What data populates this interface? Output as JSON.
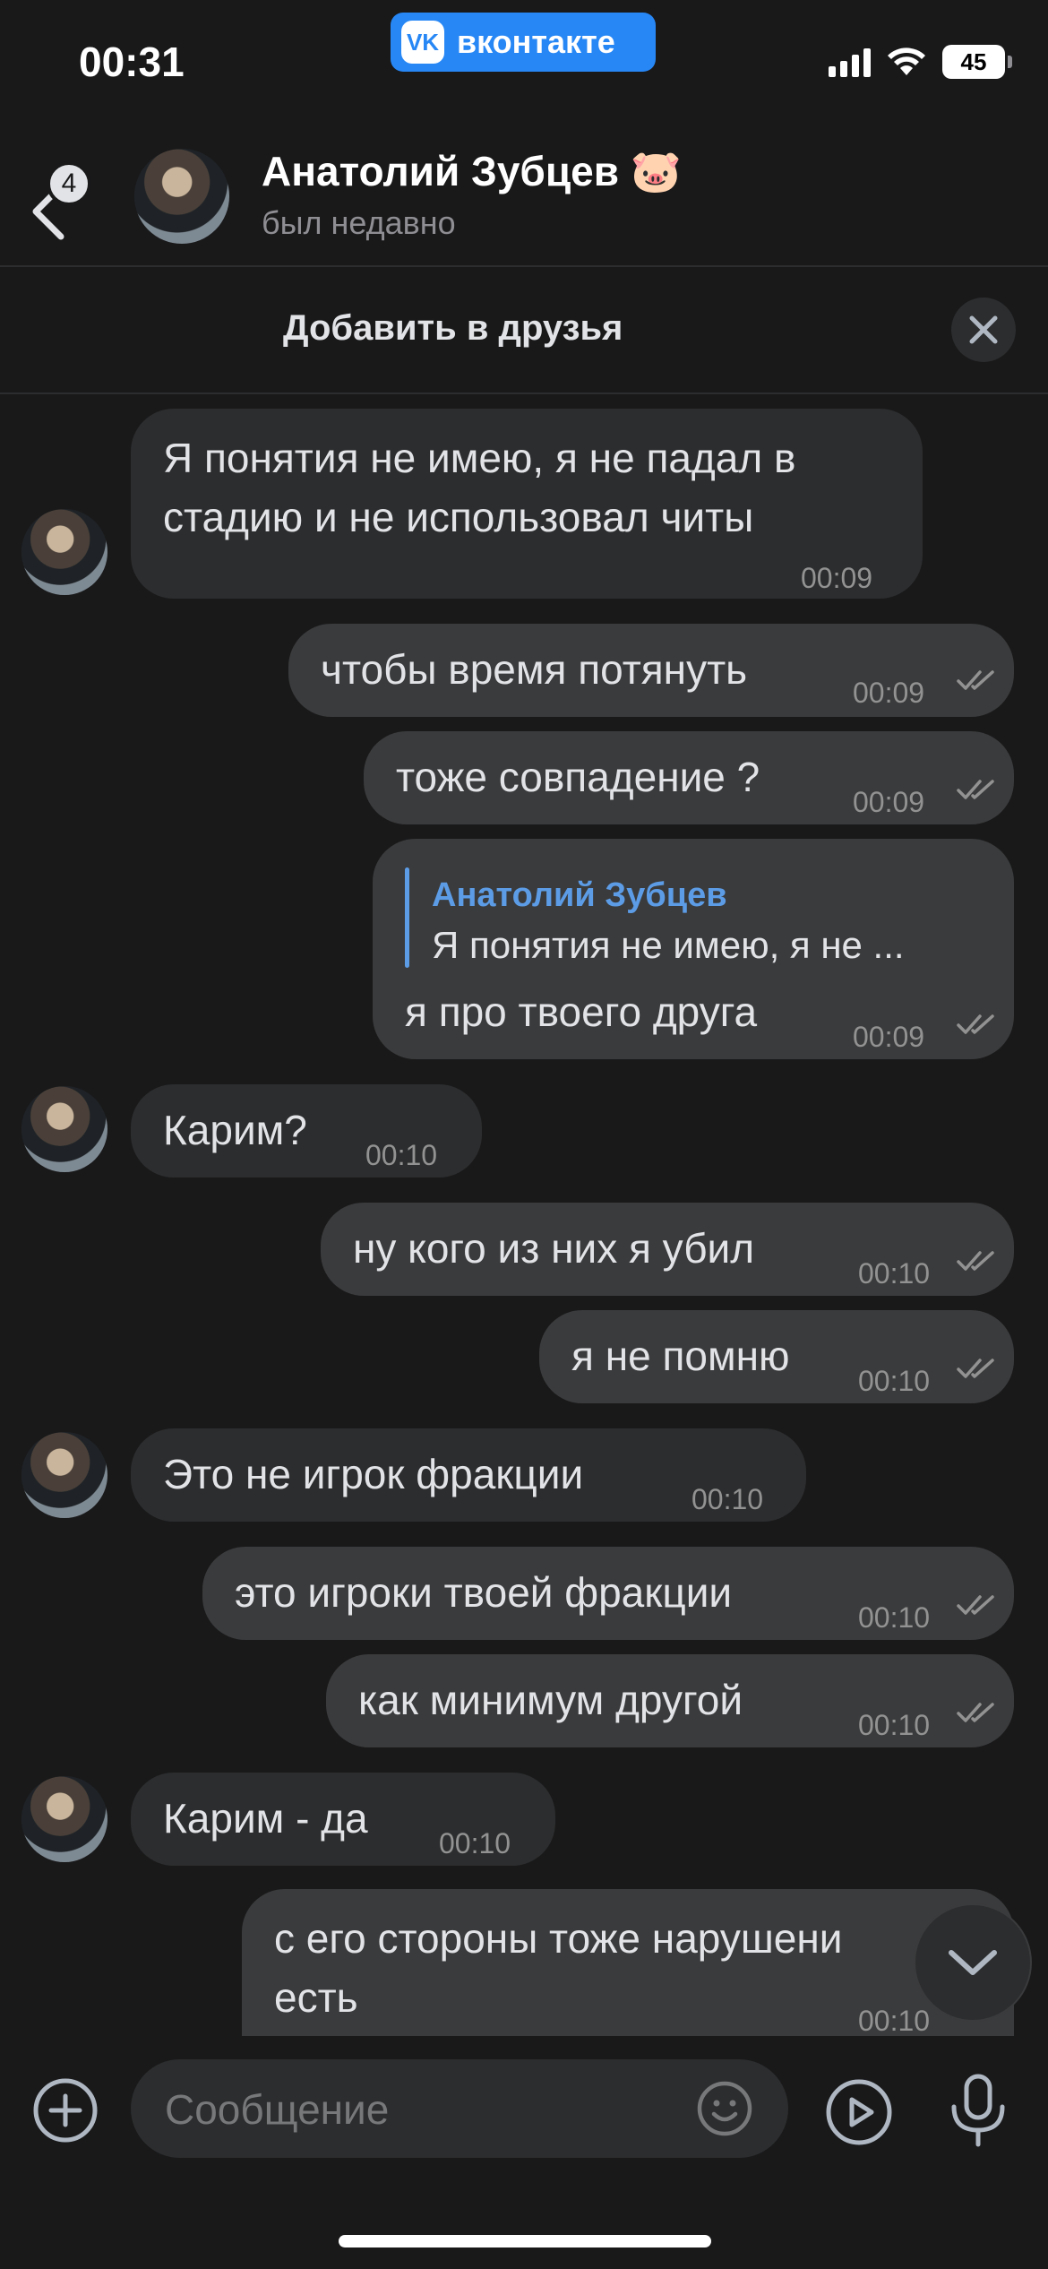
{
  "status_bar": {
    "time": "00:31",
    "app_pill": "вконтакте",
    "battery": "45"
  },
  "header": {
    "back_badge": "4",
    "name": "Анатолий Зубцев",
    "status": "был недавно"
  },
  "friend_bar": {
    "label": "Добавить в друзья"
  },
  "messages": [
    {
      "dir": "in",
      "lines": [
        "Я понятия не имею, я не падал в",
        "стадию и не использовал читы"
      ],
      "time": "00:09"
    },
    {
      "dir": "out",
      "text": "чтобы время потянуть",
      "time": "00:09",
      "read": true
    },
    {
      "dir": "out",
      "text": "тоже совпадение ?",
      "time": "00:09",
      "read": true
    },
    {
      "dir": "out",
      "reply_name": "Анатолий Зубцев",
      "reply_text": "Я понятия не имею, я не ...",
      "text": "я про твоего друга",
      "time": "00:09",
      "read": true
    },
    {
      "dir": "in",
      "text": "Карим?",
      "time": "00:10"
    },
    {
      "dir": "out",
      "text": "ну кого из них я убил",
      "time": "00:10",
      "read": true
    },
    {
      "dir": "out",
      "text": "я не помню",
      "time": "00:10",
      "read": true
    },
    {
      "dir": "in",
      "text": "Это не игрок фракции",
      "time": "00:10"
    },
    {
      "dir": "out",
      "text": "это игроки твоей фракции",
      "time": "00:10",
      "read": true
    },
    {
      "dir": "out",
      "text": "как минимум другой",
      "time": "00:10",
      "read": true
    },
    {
      "dir": "in",
      "text": "Карим - да",
      "time": "00:10"
    },
    {
      "dir": "out",
      "lines": [
        "с его стороны тоже нарушени",
        "есть"
      ],
      "time": "00:10"
    }
  ],
  "composer": {
    "placeholder": "Сообщение"
  },
  "icons": [
    "chevron-left-icon",
    "close-icon",
    "chevron-down-icon",
    "plus-icon",
    "emoji-icon",
    "video-message-icon",
    "microphone-icon",
    "double-check-icon"
  ]
}
